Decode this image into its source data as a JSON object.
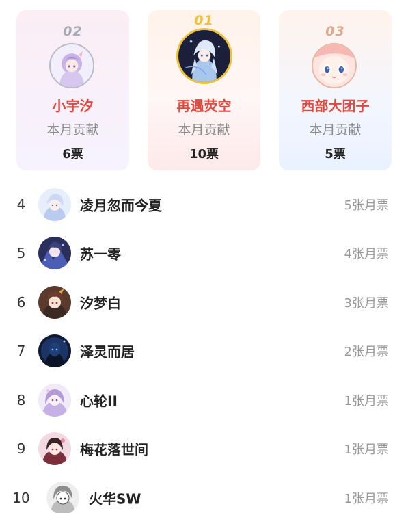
{
  "podium": [
    {
      "rank": "02",
      "name": "小宇汐",
      "label": "本月贡献",
      "votes": "6票",
      "avatar_icon": "anime-avatar-icon"
    },
    {
      "rank": "01",
      "name": "再遇荧空",
      "label": "本月贡献",
      "votes": "10票",
      "avatar_icon": "anime-avatar-icon"
    },
    {
      "rank": "03",
      "name": "西部大团子",
      "label": "本月贡献",
      "votes": "5票",
      "avatar_icon": "anime-avatar-icon"
    }
  ],
  "list": [
    {
      "rank": "4",
      "name": "凌月忽而今夏",
      "votes": "5张月票"
    },
    {
      "rank": "5",
      "name": "苏一零",
      "votes": "4张月票"
    },
    {
      "rank": "6",
      "name": "汐梦白",
      "votes": "3张月票"
    },
    {
      "rank": "7",
      "name": "泽灵而居",
      "votes": "2张月票"
    },
    {
      "rank": "8",
      "name": "心轮II",
      "votes": "1张月票"
    },
    {
      "rank": "9",
      "name": "梅花落世间",
      "votes": "1张月票"
    },
    {
      "rank": "10",
      "name": "火华SW",
      "votes": "1张月票"
    }
  ],
  "colors": {
    "name_highlight": "#e7463c",
    "gold": "#f1c136",
    "silver": "#a4aab8",
    "bronze": "#e1aa8e"
  }
}
